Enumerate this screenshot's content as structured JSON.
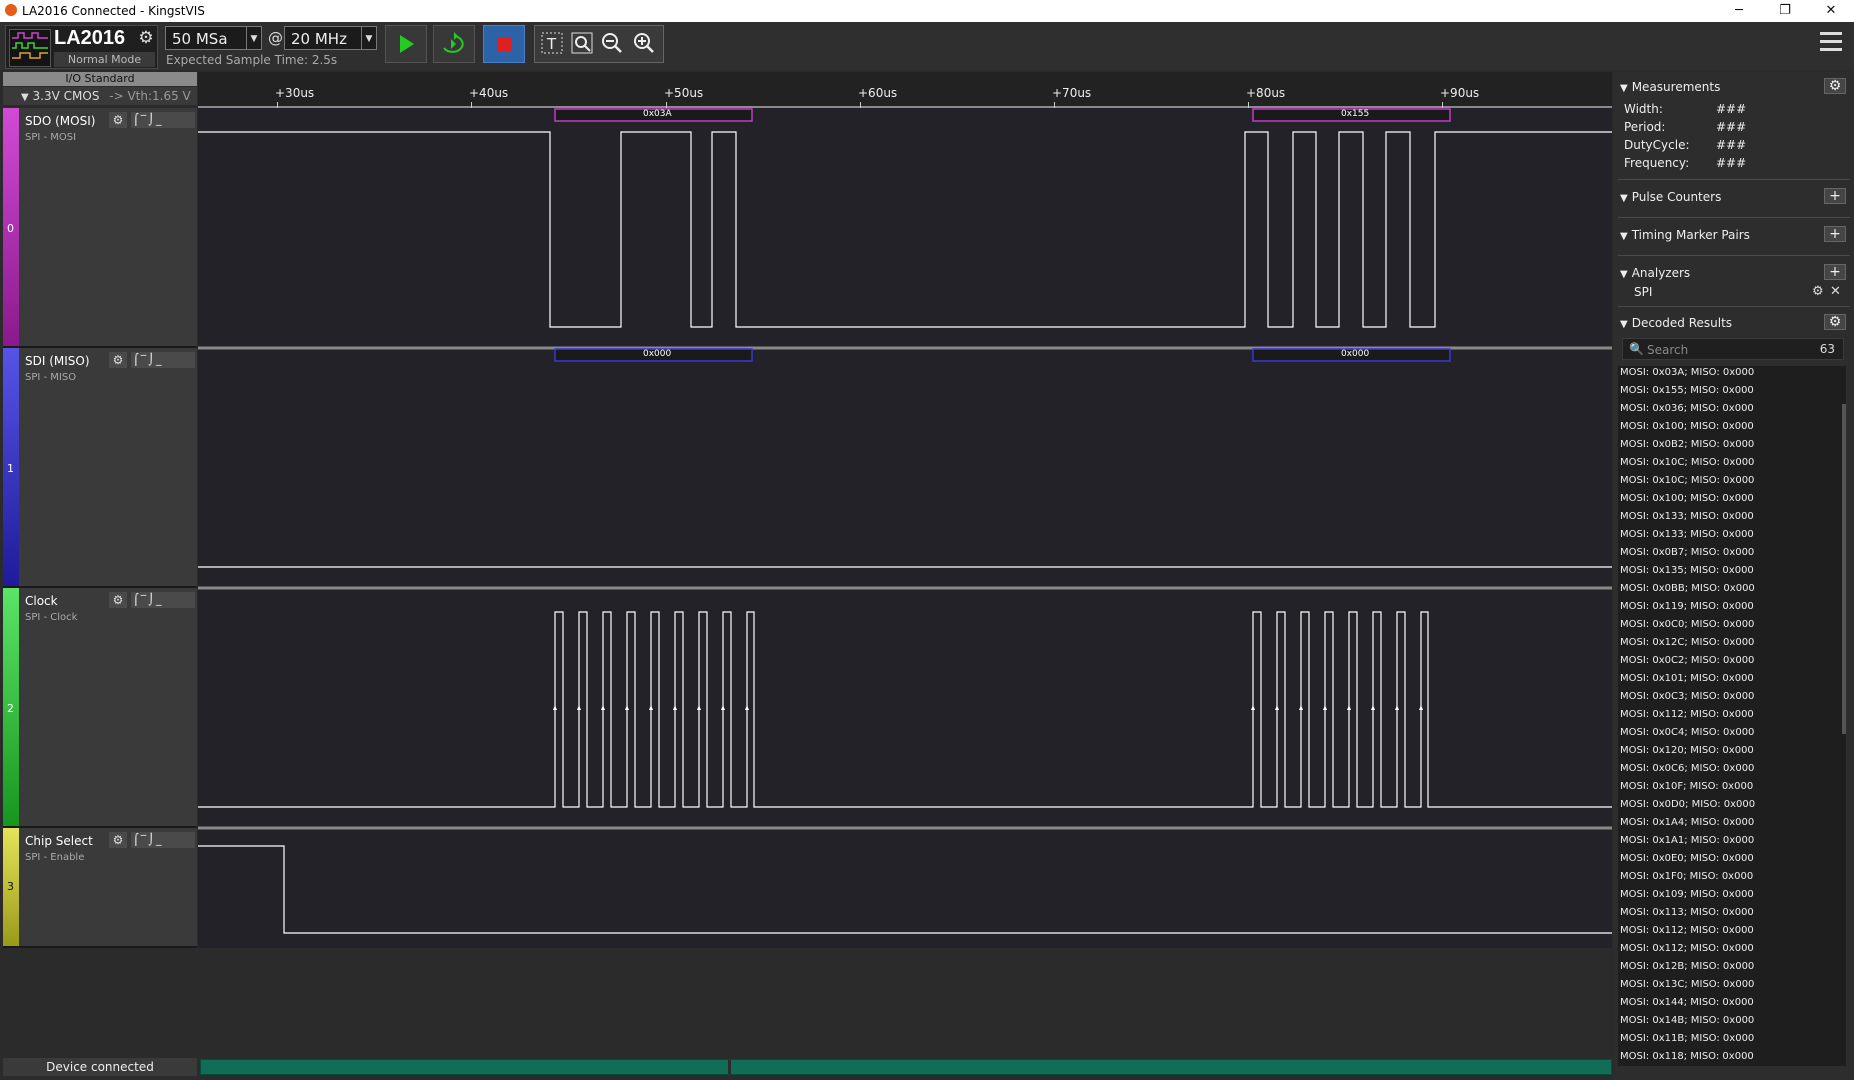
{
  "window": {
    "title": "LA2016 Connected - KingstVIS",
    "min": "─",
    "max": "❐",
    "close": "✕"
  },
  "toolbar": {
    "device_name": "LA2016",
    "device_mode": "Normal Mode",
    "sample_depth": "50 MSa",
    "at_symbol": "@",
    "sample_rate": "20 MHz",
    "expected_time": "Expected Sample Time: 2.5s"
  },
  "io_standard": {
    "label": "I/O Standard",
    "value": "3.3V CMOS",
    "vth": "-> Vth:1.65 V"
  },
  "timeline": {
    "ticks": [
      "+30us",
      "+40us",
      "+50us",
      "+60us",
      "+70us",
      "+80us",
      "+90us"
    ]
  },
  "channels": [
    {
      "index": "0",
      "name": "SDO (MOSI)",
      "sub": "SPI - MOSI",
      "color": "#c43bc8",
      "decode": [
        "0x03A",
        "0x155"
      ]
    },
    {
      "index": "1",
      "name": "SDI (MISO)",
      "sub": "SPI - MISO",
      "color": "#3a38d6",
      "decode": [
        "0x000",
        "0x000"
      ]
    },
    {
      "index": "2",
      "name": "Clock",
      "sub": "SPI - Clock",
      "color": "#2fc83a",
      "decode": []
    },
    {
      "index": "3",
      "name": "Chip Select",
      "sub": "SPI - Enable",
      "color": "#d4d431",
      "decode": []
    }
  ],
  "status": {
    "text": "Device connected"
  },
  "right_panel": {
    "measurements": {
      "title": "Measurements",
      "rows": [
        {
          "label": "Width:",
          "value": "###"
        },
        {
          "label": "Period:",
          "value": "###"
        },
        {
          "label": "DutyCycle:",
          "value": "###"
        },
        {
          "label": "Frequency:",
          "value": "###"
        }
      ]
    },
    "pulse_counters": "Pulse Counters",
    "timing_markers": "Timing Marker Pairs",
    "analyzers": {
      "title": "Analyzers",
      "item": "SPI"
    },
    "decoded": {
      "title": "Decoded Results",
      "search_placeholder": "Search",
      "count": "63",
      "results": [
        "MOSI: 0x03A;  MISO: 0x000",
        "MOSI: 0x155;  MISO: 0x000",
        "MOSI: 0x036;  MISO: 0x000",
        "MOSI: 0x100;  MISO: 0x000",
        "MOSI: 0x0B2;  MISO: 0x000",
        "MOSI: 0x10C;  MISO: 0x000",
        "MOSI: 0x10C;  MISO: 0x000",
        "MOSI: 0x100;  MISO: 0x000",
        "MOSI: 0x133;  MISO: 0x000",
        "MOSI: 0x133;  MISO: 0x000",
        "MOSI: 0x0B7;  MISO: 0x000",
        "MOSI: 0x135;  MISO: 0x000",
        "MOSI: 0x0BB;  MISO: 0x000",
        "MOSI: 0x119;  MISO: 0x000",
        "MOSI: 0x0C0;  MISO: 0x000",
        "MOSI: 0x12C;  MISO: 0x000",
        "MOSI: 0x0C2;  MISO: 0x000",
        "MOSI: 0x101;  MISO: 0x000",
        "MOSI: 0x0C3;  MISO: 0x000",
        "MOSI: 0x112;  MISO: 0x000",
        "MOSI: 0x0C4;  MISO: 0x000",
        "MOSI: 0x120;  MISO: 0x000",
        "MOSI: 0x0C6;  MISO: 0x000",
        "MOSI: 0x10F;  MISO: 0x000",
        "MOSI: 0x0D0;  MISO: 0x000",
        "MOSI: 0x1A4;  MISO: 0x000",
        "MOSI: 0x1A1;  MISO: 0x000",
        "MOSI: 0x0E0;  MISO: 0x000",
        "MOSI: 0x1F0;  MISO: 0x000",
        "MOSI: 0x109;  MISO: 0x000",
        "MOSI: 0x113;  MISO: 0x000",
        "MOSI: 0x112;  MISO: 0x000",
        "MOSI: 0x112;  MISO: 0x000",
        "MOSI: 0x12B;  MISO: 0x000",
        "MOSI: 0x13C;  MISO: 0x000",
        "MOSI: 0x144;  MISO: 0x000",
        "MOSI: 0x14B;  MISO: 0x000",
        "MOSI: 0x11B;  MISO: 0x000",
        "MOSI: 0x118;  MISO: 0x000"
      ]
    }
  }
}
